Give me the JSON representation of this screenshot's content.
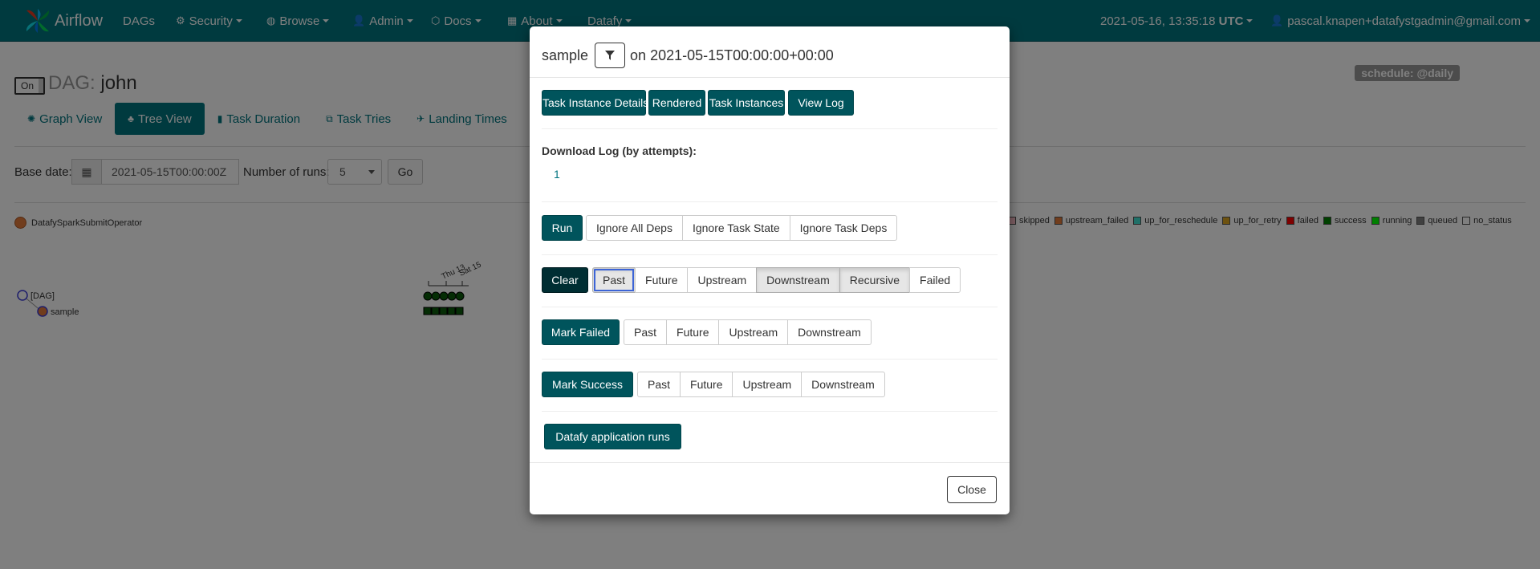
{
  "navbar": {
    "brand": "Airflow",
    "items": [
      {
        "label": "DAGs",
        "icon": ""
      },
      {
        "label": "Security",
        "icon": "cogs-icon"
      },
      {
        "label": "Browse",
        "icon": "globe-icon"
      },
      {
        "label": "Admin",
        "icon": "user-icon"
      },
      {
        "label": "Docs",
        "icon": "cube-icon"
      },
      {
        "label": "About",
        "icon": "grid-icon"
      },
      {
        "label": "Datafy",
        "icon": ""
      }
    ],
    "datetime": "2021-05-16, 13:35:18",
    "timezone": "UTC",
    "user": "pascal.knapen+datafystgadmin@gmail.com"
  },
  "dag": {
    "toggle_label": "On",
    "title_prefix": "DAG:",
    "name": "john",
    "schedule": "schedule: @daily"
  },
  "tabs": [
    {
      "label": "Graph View",
      "icon": "graph-icon"
    },
    {
      "label": "Tree View",
      "icon": "tree-icon"
    },
    {
      "label": "Task Duration",
      "icon": "bar-chart-icon"
    },
    {
      "label": "Task Tries",
      "icon": "duplicate-icon"
    },
    {
      "label": "Landing Times",
      "icon": "plane-icon"
    }
  ],
  "controls": {
    "base_date_label": "Base date:",
    "base_date_value": "2021-05-15T00:00:00Z",
    "num_runs_label": "Number of runs:",
    "num_runs_value": "5",
    "go_label": "Go"
  },
  "operator": "DatafySparkSubmitOperator",
  "legend": [
    {
      "label": "skipped",
      "color": "#ffc0cb"
    },
    {
      "label": "upstream_failed",
      "color": "#e37a3a"
    },
    {
      "label": "up_for_reschedule",
      "color": "#40e0d0"
    },
    {
      "label": "up_for_retry",
      "color": "#daa520"
    },
    {
      "label": "failed",
      "color": "#ff0000"
    },
    {
      "label": "success",
      "color": "#008000"
    },
    {
      "label": "running",
      "color": "#00ff00"
    },
    {
      "label": "queued",
      "color": "#808080"
    },
    {
      "label": "no_status",
      "color": "#ffffff"
    }
  ],
  "tree": {
    "root": "[DAG]",
    "task": "sample",
    "date_labels": [
      "Thu 13",
      "Sat 15"
    ]
  },
  "modal": {
    "task": "sample",
    "on": "on",
    "execution_date": "2021-05-15T00:00:00+00:00",
    "top_buttons": [
      "Task Instance Details",
      "Rendered",
      "Task Instances",
      "View Log"
    ],
    "download_label": "Download Log (by attempts):",
    "attempt": "1",
    "run_label": "Run",
    "run_options": [
      "Ignore All Deps",
      "Ignore Task State",
      "Ignore Task Deps"
    ],
    "clear_label": "Clear",
    "clear_options": [
      "Past",
      "Future",
      "Upstream",
      "Downstream",
      "Recursive",
      "Failed"
    ],
    "mark_failed_label": "Mark Failed",
    "mark_failed_options": [
      "Past",
      "Future",
      "Upstream",
      "Downstream"
    ],
    "mark_success_label": "Mark Success",
    "mark_success_options": [
      "Past",
      "Future",
      "Upstream",
      "Downstream"
    ],
    "datafy_label": "Datafy application runs",
    "close_label": "Close"
  }
}
